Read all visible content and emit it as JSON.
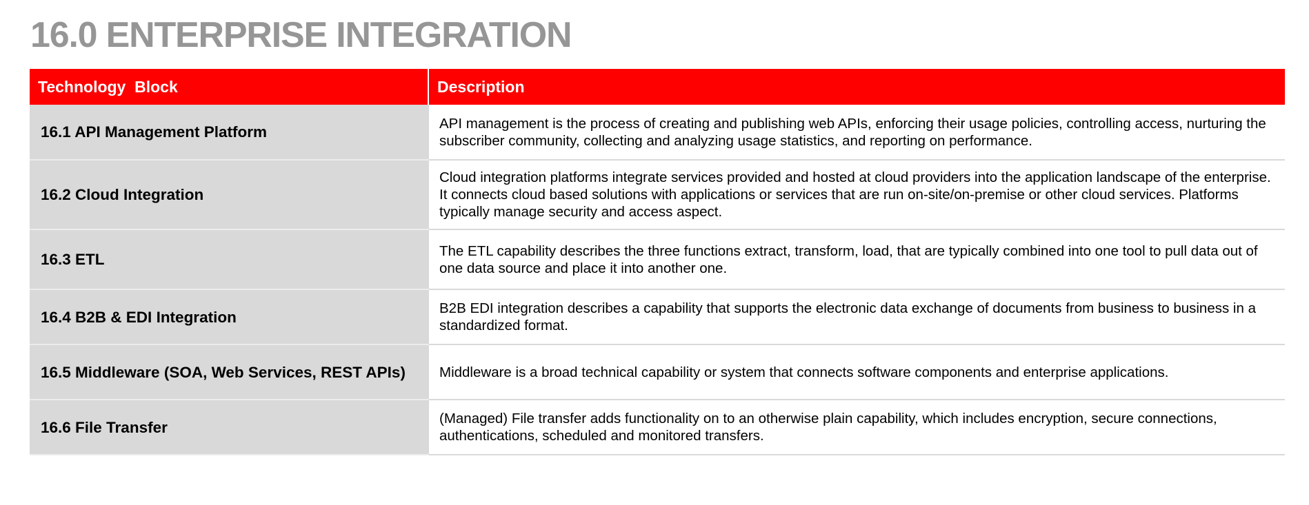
{
  "page": {
    "title": "16.0 ENTERPRISE INTEGRATION"
  },
  "table": {
    "headers": {
      "block": "Technology  Block",
      "description": "Description"
    },
    "rows": [
      {
        "block": "16.1 API Management Platform",
        "description": "API management is the process of creating and publishing web APIs, enforcing their usage policies, controlling access, nurturing the subscriber community, collecting and analyzing usage statistics, and reporting on performance."
      },
      {
        "block": "16.2 Cloud Integration",
        "description": "Cloud integration platforms integrate services provided and hosted at cloud providers into the application landscape of the enterprise. It connects cloud based solutions with applications or services that are run on-site/on-premise or other cloud services. Platforms typically manage security and access aspect."
      },
      {
        "block": "16.3 ETL",
        "description": "The ETL capability describes the three functions extract, transform, load, that are typically combined into one tool to pull data out of one data source and place it into another one."
      },
      {
        "block": "16.4 B2B & EDI Integration",
        "description": "B2B EDI integration describes a capability that supports the electronic data exchange of documents from business to business in a standardized format."
      },
      {
        "block": "16.5 Middleware (SOA, Web Services, REST APIs)",
        "description": "Middleware is a broad technical capability or system that connects software components and enterprise applications."
      },
      {
        "block": "16.6 File Transfer",
        "description": "(Managed) File transfer adds functionality on to an otherwise plain capability, which includes encryption, secure connections, authentications, scheduled and monitored transfers."
      }
    ]
  },
  "colors": {
    "title": "#969696",
    "header_background": "#ff0000",
    "header_text": "#ffffff",
    "block_cell_background": "#d9d9d9",
    "description_cell_background": "#ffffff",
    "row_divider": "#d9d9d9"
  }
}
